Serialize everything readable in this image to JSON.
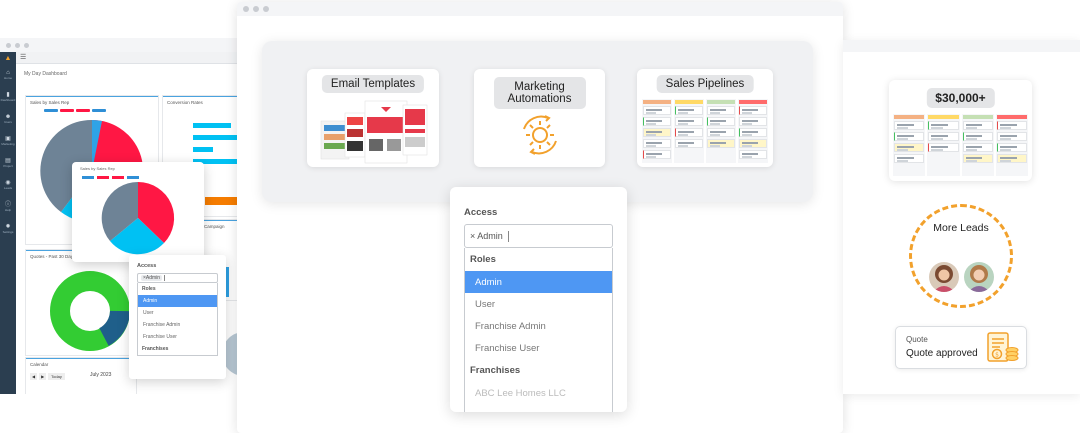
{
  "dashboard": {
    "breadcrumb": "My Day Dashboard",
    "sidebar": [
      {
        "icon": "home-icon",
        "glyph": "⌂",
        "label": "Home"
      },
      {
        "icon": "chart-icon",
        "glyph": "▮",
        "label": "Dashboard"
      },
      {
        "icon": "users-icon",
        "glyph": "☻",
        "label": "Users"
      },
      {
        "icon": "briefcase-icon",
        "glyph": "▣",
        "label": "Marketing"
      },
      {
        "icon": "table-icon",
        "glyph": "▤",
        "label": "Project"
      },
      {
        "icon": "calendar-icon",
        "glyph": "◉",
        "label": "Leads"
      },
      {
        "icon": "info-icon",
        "glyph": "ⓘ",
        "label": "Help"
      },
      {
        "icon": "gear-icon",
        "glyph": "✹",
        "label": "Settings"
      }
    ],
    "panels": {
      "sales_by_sales_rep": "Sales by Sales Rep",
      "conversion_rates": "Conversion Rates",
      "quotes": "Quotes - Past 30 Days",
      "campaign": "Campaign",
      "calendar": "Calendar",
      "calendar_month": "July 2023",
      "today_button": "Today"
    },
    "popup_title": "Sales by Sales Rep"
  },
  "small_access": {
    "label": "Access",
    "chip": "×Admin",
    "groups": [
      {
        "name": "Roles",
        "options": [
          {
            "label": "Admin",
            "selected": true
          },
          {
            "label": "User"
          },
          {
            "label": "Franchise Admin"
          },
          {
            "label": "Franchise User"
          }
        ]
      },
      {
        "name": "Franchises",
        "options": []
      }
    ]
  },
  "features": {
    "email_templates": "Email Templates",
    "marketing_automations": "Marketing Automations",
    "sales_pipelines": "Sales Pipelines"
  },
  "access": {
    "label": "Access",
    "chip": "× Admin",
    "groups": [
      {
        "name": "Roles",
        "options": [
          {
            "label": "Admin",
            "selected": true
          },
          {
            "label": "User"
          },
          {
            "label": "Franchise Admin"
          },
          {
            "label": "Franchise User"
          }
        ]
      },
      {
        "name": "Franchises",
        "options": [
          {
            "label": "ABC Lee Homes LLC"
          }
        ]
      }
    ]
  },
  "right": {
    "amount": "$30,000+",
    "more_leads": "More Leads",
    "quote_label": "Quote",
    "quote_status": "Quote approved"
  },
  "colors": {
    "accent_blue": "#4e97f3",
    "orange": "#f2a12c",
    "sidebar": "#2b3e50",
    "pie_red": "#ff1744",
    "pie_cyan": "#00c1f3",
    "pie_slate": "#6e8396",
    "donut_green": "#33cc33"
  }
}
